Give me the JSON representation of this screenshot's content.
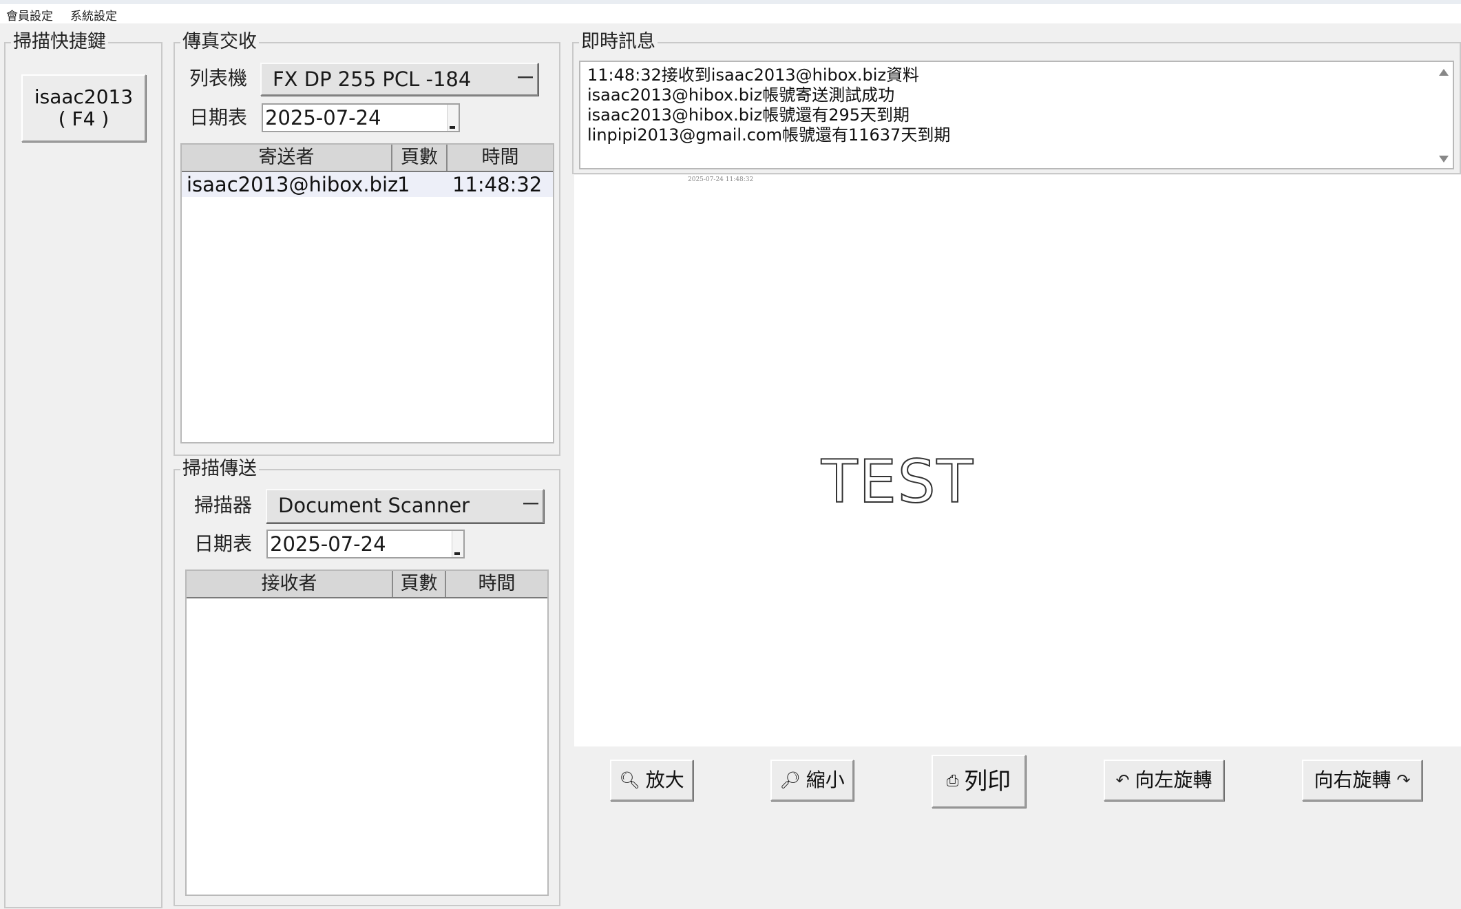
{
  "menu": {
    "items": [
      "會員設定",
      "系統設定"
    ]
  },
  "scan_shortcut": {
    "title": "掃描快捷鍵",
    "button_line1": "isaac2013",
    "button_line2": "( F4 )"
  },
  "fax": {
    "title": "傳真交收",
    "printer_label": "列表機",
    "printer_value": "FX DP 255 PCL -184",
    "date_label": "日期表",
    "date_value": "2025-07-24",
    "columns": [
      "寄送者",
      "頁數",
      "時間"
    ],
    "rows": [
      {
        "sender": "isaac2013@hibox.biz",
        "pages": "1",
        "time": "11:48:32"
      }
    ]
  },
  "scan_send": {
    "title": "掃描傳送",
    "scanner_label": "掃描器",
    "scanner_value": "Document Scanner",
    "date_label": "日期表",
    "date_value": "2025-07-24",
    "columns": [
      "接收者",
      "頁數",
      "時間"
    ]
  },
  "messages": {
    "title": "即時訊息",
    "lines": [
      "11:48:32接收到isaac2013@hibox.biz資料",
      "isaac2013@hibox.biz帳號寄送測試成功",
      "isaac2013@hibox.biz帳號還有295天到期",
      "linpipi2013@gmail.com帳號還有11637天到期"
    ]
  },
  "preview": {
    "timestamp": "2025-07-24 11:48:32",
    "text": "TEST"
  },
  "toolbar": {
    "zoom_in": "放大",
    "zoom_out": "縮小",
    "print": "列印",
    "rotate_left": "向左旋轉",
    "rotate_right": "向右旋轉"
  },
  "icons": {
    "zoom_in": "magnifier-plus-icon",
    "zoom_out": "magnifier-minus-icon",
    "print": "printer-icon",
    "rotate_left": "rotate-left-icon",
    "rotate_right": "rotate-right-icon"
  },
  "colors": {
    "window_bg": "#f0f0f0",
    "selected_row_bg": "#edeff8",
    "header_bg": "#d7d7d7"
  }
}
